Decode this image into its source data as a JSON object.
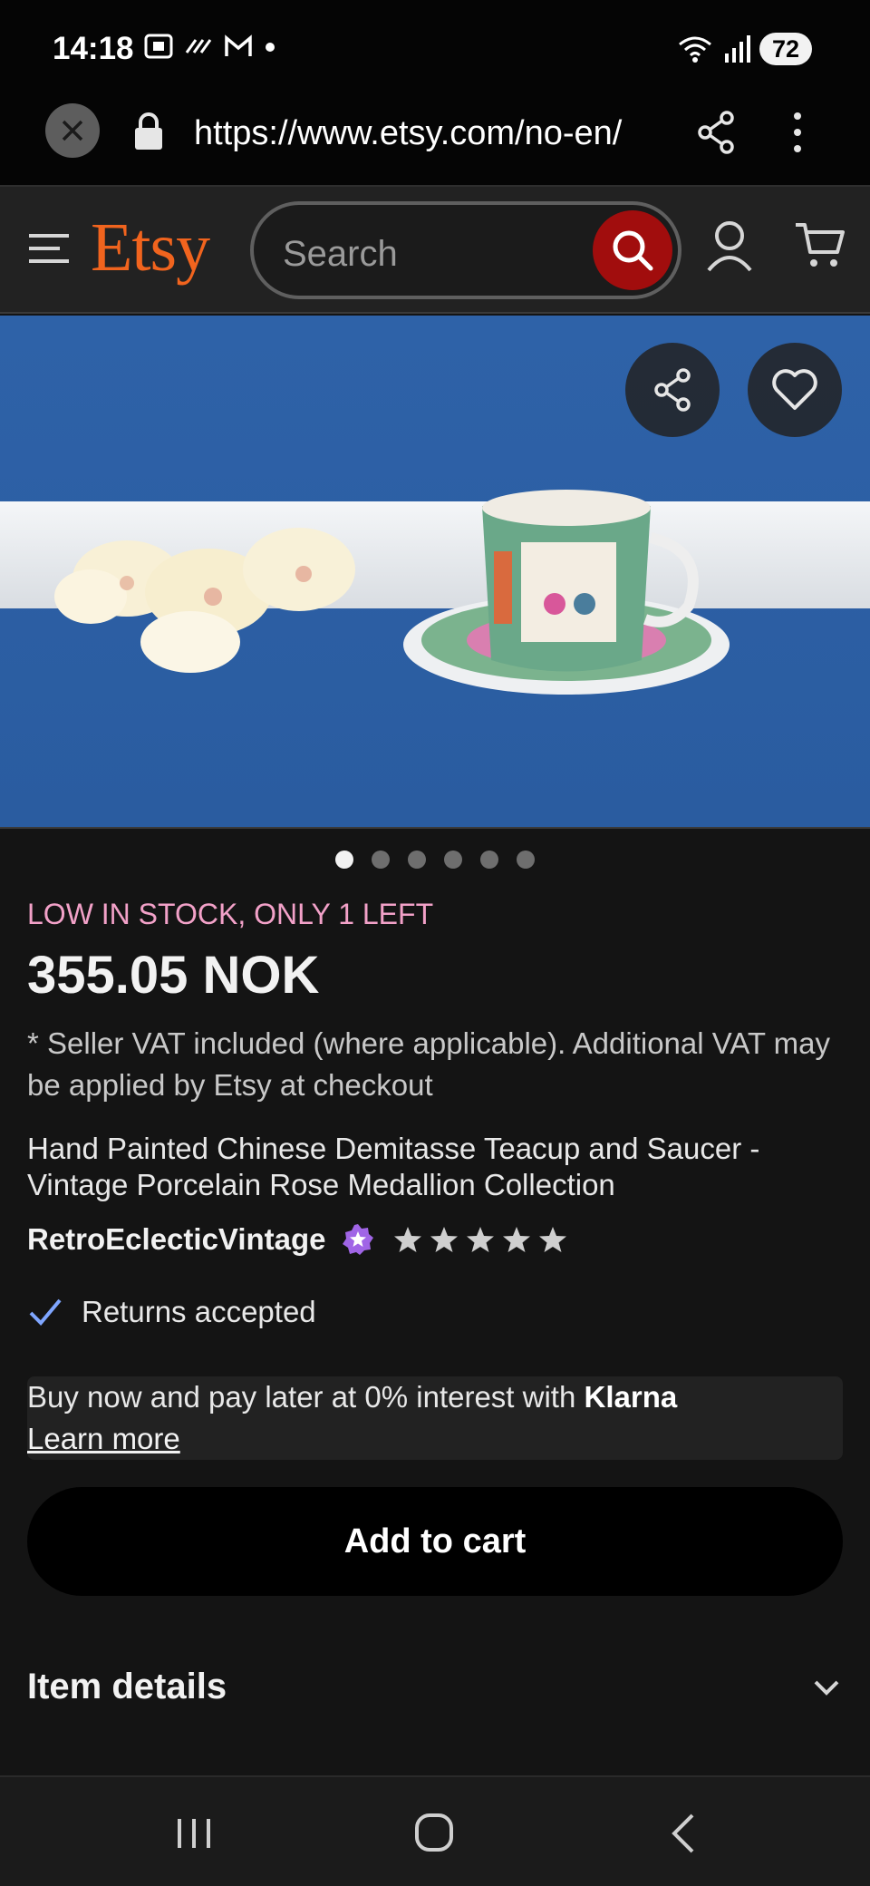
{
  "status_bar": {
    "time": "14:18",
    "battery": "72"
  },
  "browser": {
    "url": "https://www.etsy.com/no-en/"
  },
  "header": {
    "logo": "Etsy",
    "search_placeholder": "Search",
    "brand_color": "#f1641e",
    "search_button_color": "#a10d0d"
  },
  "gallery": {
    "image_count": 6,
    "active_index": 0
  },
  "product": {
    "stock_notice": "LOW IN STOCK, ONLY 1 LEFT",
    "price": "355.05 NOK",
    "vat_note": "* Seller VAT included (where applicable). Additional VAT may be applied by Etsy at checkout",
    "title": "Hand Painted Chinese Demitasse Teacup and Saucer - Vintage Porcelain Rose Medallion Collection",
    "seller": "RetroEclecticVintage",
    "rating_stars": 5,
    "returns": "Returns accepted"
  },
  "klarna": {
    "text": "Buy now and pay later at 0% interest with ",
    "brand": "Klarna",
    "learn_more": "Learn more"
  },
  "actions": {
    "add_to_cart": "Add to cart"
  },
  "sections": {
    "item_details": "Item details"
  },
  "icons": [
    "close-icon",
    "lock-icon",
    "share-icon",
    "more-icon",
    "menu-icon",
    "search-icon",
    "account-icon",
    "cart-icon",
    "heart-icon",
    "star-seller-icon",
    "star-icon",
    "check-icon",
    "chevron-down-icon",
    "recent-apps-icon",
    "home-icon",
    "back-icon"
  ]
}
